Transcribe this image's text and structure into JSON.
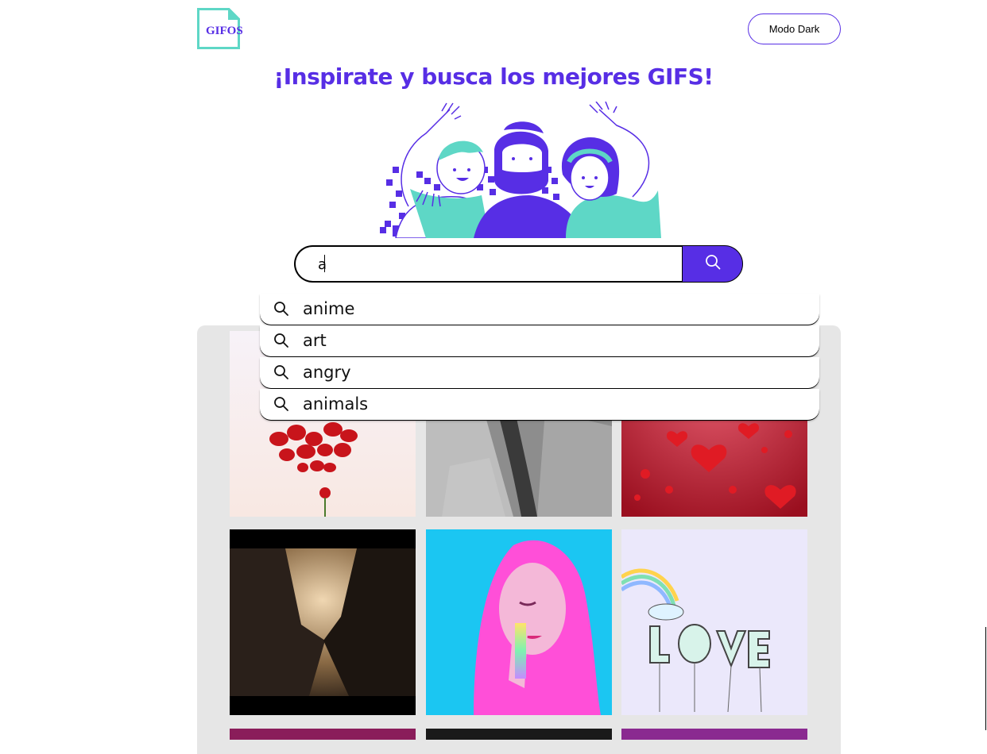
{
  "header": {
    "logo_text": "GIFOS",
    "mode_button_label": "Modo Dark"
  },
  "hero": {
    "headline": "¡Inspirate y busca los mejores GIFS!",
    "illustration_icon": "three-people-waving-illustration"
  },
  "search": {
    "value": "a",
    "button_icon": "search-icon"
  },
  "suggestions": [
    {
      "label": "anime",
      "icon": "search-icon"
    },
    {
      "label": "art",
      "icon": "search-icon"
    },
    {
      "label": "angry",
      "icon": "search-icon"
    },
    {
      "label": "animals",
      "icon": "search-icon"
    }
  ],
  "colors": {
    "accent": "#572EE5",
    "teal": "#5ED7C6",
    "grid_background": "#E6E6E6"
  },
  "gifs": [
    {
      "subject": "rose-petals-heart"
    },
    {
      "subject": "hands-grayscale"
    },
    {
      "subject": "red-hearts-falling"
    },
    {
      "subject": "couple-holding-hands-sunset"
    },
    {
      "subject": "pink-hair-girl-illustration"
    },
    {
      "subject": "love-balloons-rainbow"
    },
    {
      "subject": "purple-gif-partial"
    },
    {
      "subject": "dark-gif-partial"
    },
    {
      "subject": "magenta-gif-partial"
    }
  ]
}
